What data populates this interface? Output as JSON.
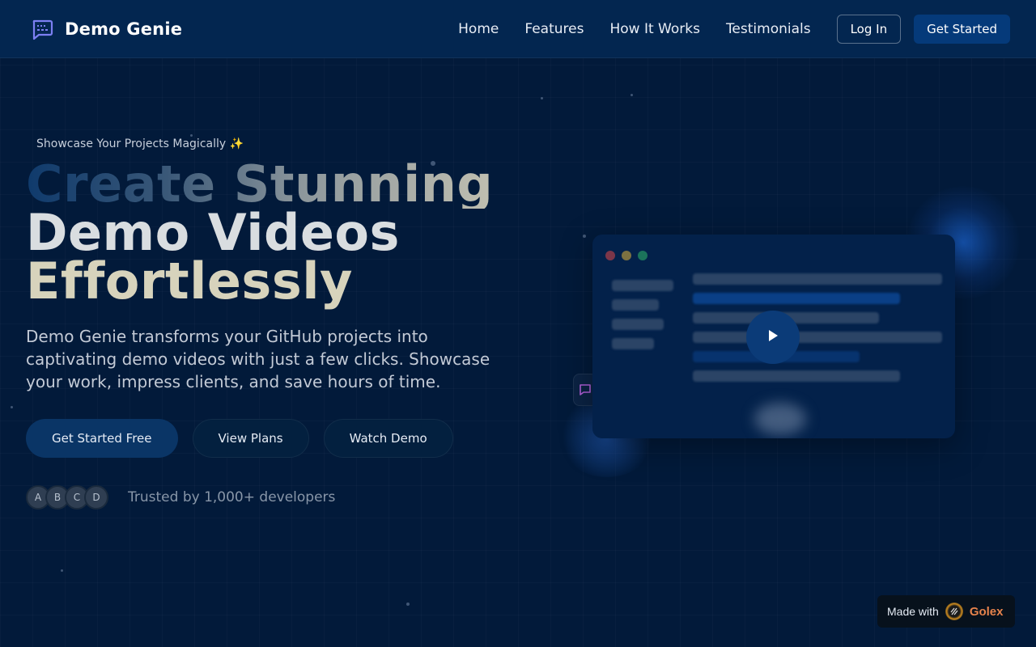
{
  "brand": {
    "name": "Demo Genie",
    "icon": "chat-bubble-icon",
    "accent": "#7c7ff2"
  },
  "nav": {
    "links": [
      "Home",
      "Features",
      "How It Works",
      "Testimonials"
    ],
    "login_label": "Log In",
    "get_started_label": "Get Started"
  },
  "hero": {
    "tagline": "Showcase Your Projects Magically ✨",
    "headline": [
      "Create Stunning",
      "Demo Videos",
      "Effortlessly"
    ],
    "description": "Demo Genie transforms your GitHub projects into captivating demo videos with just a few clicks. Showcase your work, impress clients, and save hours of time.",
    "cta_primary": "Get Started Free",
    "cta_plans": "View Plans",
    "cta_demo": "Watch Demo",
    "avatars": [
      "A",
      "B",
      "C",
      "D"
    ],
    "trust_text": "Trusted by 1,000+ developers"
  },
  "preview": {
    "window_dots": [
      "#e04848",
      "#e0b53a",
      "#2fb86a"
    ],
    "play_icon": "play-icon",
    "chat_icon": "chat-icon"
  },
  "badge": {
    "made_with": "Made with",
    "brand": "Golex",
    "brand_color": "#e7834c"
  },
  "colors": {
    "background": "#021a3a",
    "nav": "#032650",
    "primary_button": "#0a3566"
  }
}
